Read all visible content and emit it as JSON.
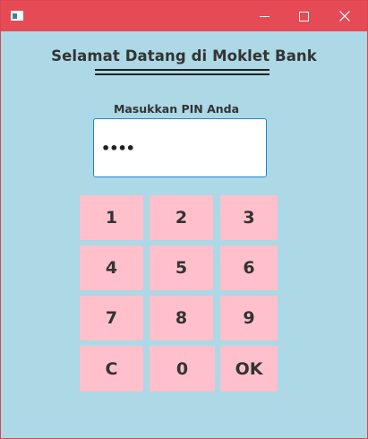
{
  "window": {
    "accent_color": "#e64a55",
    "background_color": "#add8e6",
    "controls": {
      "minimize_icon": "minimize-icon",
      "maximize_icon": "maximize-icon",
      "close_icon": "close-icon"
    }
  },
  "header": {
    "title": "Selamat Datang di Moklet Bank"
  },
  "pin": {
    "label": "Masukkan PIN Anda",
    "value": "••••"
  },
  "keypad": {
    "key_color": "#ffc0cb",
    "keys": [
      "1",
      "2",
      "3",
      "4",
      "5",
      "6",
      "7",
      "8",
      "9",
      "C",
      "0",
      "OK"
    ]
  }
}
